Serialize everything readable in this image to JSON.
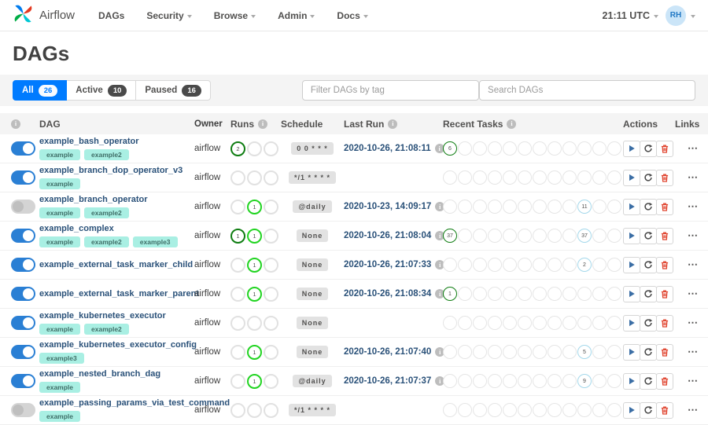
{
  "nav": {
    "brand": "Airflow",
    "items": [
      {
        "label": "DAGs",
        "dropdown": false
      },
      {
        "label": "Security",
        "dropdown": true
      },
      {
        "label": "Browse",
        "dropdown": true
      },
      {
        "label": "Admin",
        "dropdown": true
      },
      {
        "label": "Docs",
        "dropdown": true
      }
    ],
    "clock": "21:11 UTC",
    "avatar": "RH"
  },
  "page": {
    "title": "DAGs"
  },
  "filters": {
    "tabs": [
      {
        "label": "All",
        "count": "26",
        "active": true
      },
      {
        "label": "Active",
        "count": "10",
        "active": false
      },
      {
        "label": "Paused",
        "count": "16",
        "active": false
      }
    ],
    "tag_filter_placeholder": "Filter DAGs by tag",
    "search_placeholder": "Search DAGs"
  },
  "table": {
    "columns": [
      "DAG",
      "Owner",
      "Runs",
      "Schedule",
      "Last Run",
      "Recent Tasks",
      "Actions",
      "Links"
    ],
    "runs_slots": 3,
    "recent_slots": 12,
    "rows": [
      {
        "name": "example_bash_operator",
        "enabled": true,
        "tags": [
          "example",
          "example2"
        ],
        "owner": "airflow",
        "runs": [
          {
            "slot": 0,
            "count": "2",
            "state": "success"
          }
        ],
        "schedule": "0 0 * * *",
        "last_run": "2020-10-26, 21:08:11",
        "recent": [
          {
            "slot": 0,
            "count": "6",
            "state": "success"
          }
        ]
      },
      {
        "name": "example_branch_dop_operator_v3",
        "enabled": true,
        "tags": [
          "example"
        ],
        "owner": "airflow",
        "runs": [],
        "schedule": "*/1 * * * *",
        "last_run": "",
        "recent": []
      },
      {
        "name": "example_branch_operator",
        "enabled": false,
        "tags": [
          "example",
          "example2"
        ],
        "owner": "airflow",
        "runs": [
          {
            "slot": 1,
            "count": "1",
            "state": "running"
          }
        ],
        "schedule": "@daily",
        "last_run": "2020-10-23, 14:09:17",
        "recent": [
          {
            "slot": 9,
            "count": "11",
            "state": "none"
          }
        ]
      },
      {
        "name": "example_complex",
        "enabled": true,
        "tags": [
          "example",
          "example2",
          "example3"
        ],
        "owner": "airflow",
        "runs": [
          {
            "slot": 0,
            "count": "1",
            "state": "success"
          },
          {
            "slot": 1,
            "count": "1",
            "state": "running"
          }
        ],
        "schedule": "None",
        "last_run": "2020-10-26, 21:08:04",
        "recent": [
          {
            "slot": 0,
            "count": "37",
            "state": "success"
          },
          {
            "slot": 9,
            "count": "37",
            "state": "none"
          }
        ]
      },
      {
        "name": "example_external_task_marker_child",
        "enabled": true,
        "tags": [],
        "owner": "airflow",
        "runs": [
          {
            "slot": 1,
            "count": "1",
            "state": "running"
          }
        ],
        "schedule": "None",
        "last_run": "2020-10-26, 21:07:33",
        "recent": [
          {
            "slot": 9,
            "count": "2",
            "state": "none"
          }
        ]
      },
      {
        "name": "example_external_task_marker_parent",
        "enabled": true,
        "tags": [],
        "owner": "airflow",
        "runs": [
          {
            "slot": 1,
            "count": "1",
            "state": "running"
          }
        ],
        "schedule": "None",
        "last_run": "2020-10-26, 21:08:34",
        "recent": [
          {
            "slot": 0,
            "count": "1",
            "state": "success"
          }
        ]
      },
      {
        "name": "example_kubernetes_executor",
        "enabled": true,
        "tags": [
          "example",
          "example2"
        ],
        "owner": "airflow",
        "runs": [],
        "schedule": "None",
        "last_run": "",
        "recent": []
      },
      {
        "name": "example_kubernetes_executor_config",
        "enabled": true,
        "tags": [
          "example3"
        ],
        "owner": "airflow",
        "runs": [
          {
            "slot": 1,
            "count": "1",
            "state": "running"
          }
        ],
        "schedule": "None",
        "last_run": "2020-10-26, 21:07:40",
        "recent": [
          {
            "slot": 9,
            "count": "5",
            "state": "none"
          }
        ]
      },
      {
        "name": "example_nested_branch_dag",
        "enabled": true,
        "tags": [
          "example"
        ],
        "owner": "airflow",
        "runs": [
          {
            "slot": 1,
            "count": "1",
            "state": "running"
          }
        ],
        "schedule": "@daily",
        "last_run": "2020-10-26, 21:07:37",
        "recent": [
          {
            "slot": 9,
            "count": "9",
            "state": "none"
          }
        ]
      },
      {
        "name": "example_passing_params_via_test_command",
        "enabled": false,
        "tags": [
          "example"
        ],
        "owner": "airflow",
        "runs": [],
        "schedule": "*/1 * * * *",
        "last_run": "",
        "recent": []
      }
    ]
  },
  "colors": {
    "active_tab": "#007bff",
    "toggle_on": "#2a7fd4",
    "state_success": "#0f7d12",
    "state_running": "#21d421",
    "state_none": "#a4d8eb",
    "trigger_icon": "#3b6ea5",
    "refresh_icon": "#4a4a4a",
    "delete_icon": "#e0432e",
    "tag_bg": "#a9efe3",
    "tag_text": "#3f6e67",
    "link": "#2a5179",
    "logo_blue": "#017cee",
    "logo_teal": "#00c7d4",
    "logo_red": "#e43921",
    "logo_green": "#00ad46"
  }
}
